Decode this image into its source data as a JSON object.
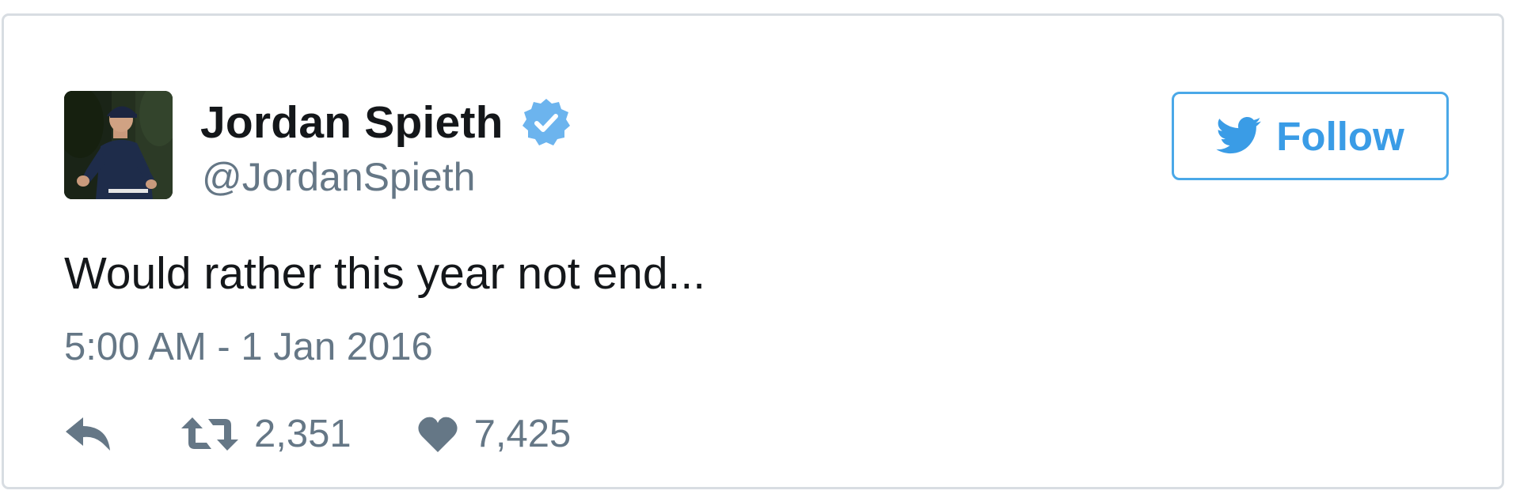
{
  "user": {
    "name": "Jordan Spieth",
    "handle": "@JordanSpieth",
    "verified_icon": "verified-badge-icon",
    "verified_color": "#6cb4ee"
  },
  "follow_button": {
    "label": "Follow",
    "icon": "twitter-bird-icon",
    "color": "#3a9ce6"
  },
  "tweet": {
    "text": "Would rather this year not end...",
    "timestamp": "5:00 AM - 1 Jan 2016"
  },
  "actions": {
    "reply_icon": "reply-icon",
    "retweet_icon": "retweet-icon",
    "retweet_count": "2,351",
    "like_icon": "heart-icon",
    "like_count": "7,425",
    "icon_color": "#657786"
  }
}
